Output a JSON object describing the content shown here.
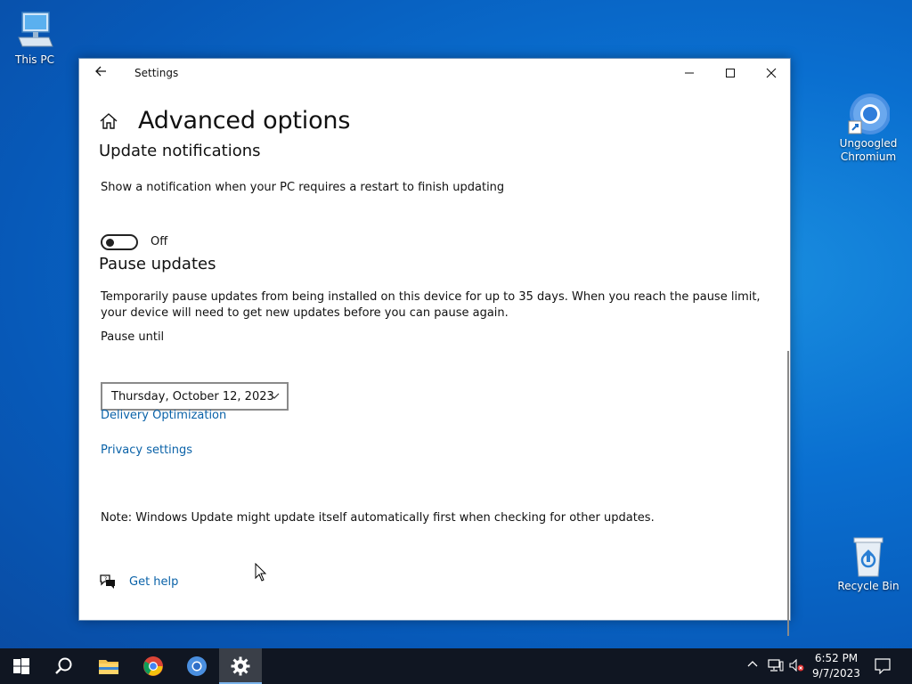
{
  "desktop": {
    "icons": [
      {
        "label": "This PC"
      },
      {
        "label": "Ungoogled Chromium"
      },
      {
        "label": "Recycle Bin"
      }
    ]
  },
  "window": {
    "title": "Settings",
    "page_title": "Advanced options",
    "update_notifications": {
      "heading": "Update notifications",
      "description": "Show a notification when your PC requires a restart to finish updating",
      "toggle_state": "Off"
    },
    "pause_updates": {
      "heading": "Pause updates",
      "description": "Temporarily pause updates from being installed on this device for up to 35 days. When you reach the pause limit, your device will need to get new updates before you can pause again.",
      "pause_until_label": "Pause until",
      "pause_until_value": "Thursday, October 12, 2023"
    },
    "links": {
      "delivery_optimization": "Delivery Optimization",
      "privacy_settings": "Privacy settings"
    },
    "note": "Note: Windows Update might update itself automatically first when checking for other updates.",
    "get_help": "Get help"
  },
  "taskbar": {
    "time": "6:52 PM",
    "date": "9/7/2023"
  },
  "colors": {
    "link": "#0a62a8",
    "taskbar": "#101622",
    "desktop": "#0a6fd0"
  }
}
